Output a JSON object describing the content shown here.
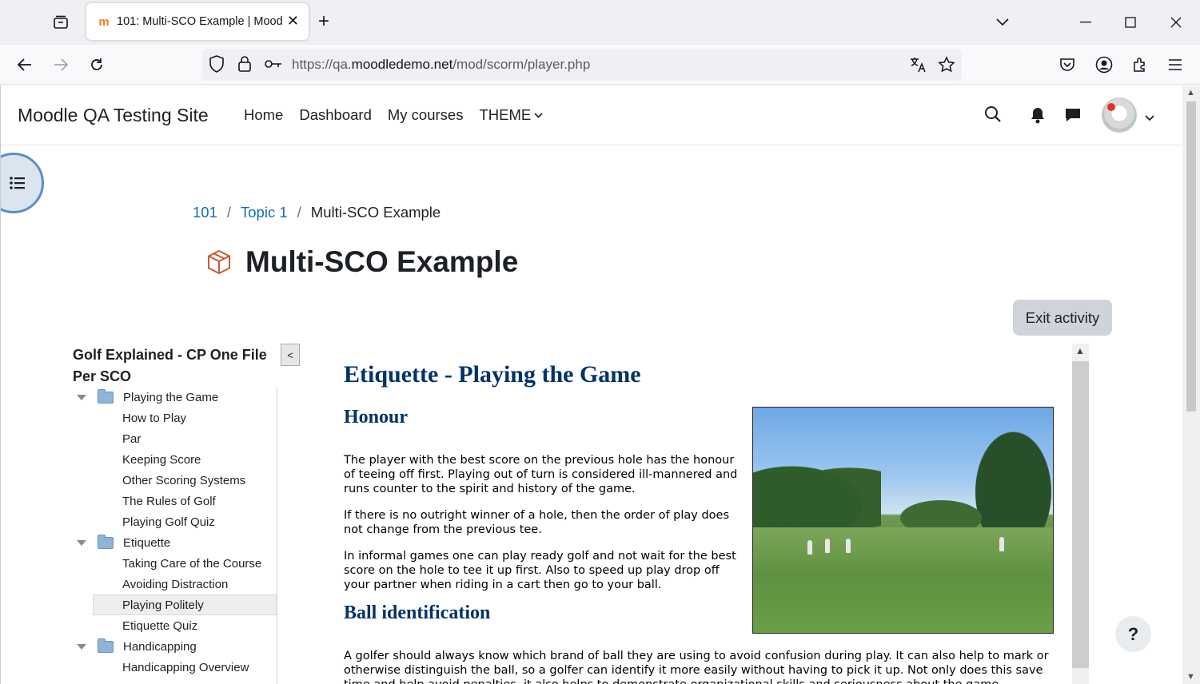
{
  "browser": {
    "tab": {
      "title": "101: Multi-SCO Example | Mood",
      "favicon": "moodle-favicon"
    },
    "url": {
      "prefix": "https://qa.",
      "domain": "moodledemo.net",
      "path": "/mod/scorm/player.php"
    },
    "icons": [
      "tab-list-icon",
      "back-icon",
      "forward-icon",
      "reload-icon",
      "shield-icon",
      "lock-icon",
      "key-icon",
      "translate-icon",
      "star-icon",
      "pocket-icon",
      "account-icon",
      "extensions-icon",
      "menu-icon",
      "minimize-icon",
      "maximize-icon",
      "close-icon"
    ]
  },
  "moodle": {
    "site_name": "Moodle QA Testing Site",
    "nav": {
      "home": "Home",
      "dashboard": "Dashboard",
      "my_courses": "My courses",
      "theme": "THEME"
    },
    "breadcrumb": {
      "course": "101",
      "sep": "/",
      "topic": "Topic 1",
      "current": "Multi-SCO Example"
    },
    "page_title": "Multi-SCO Example",
    "exit_button": "Exit activity",
    "help_button": "?"
  },
  "toc": {
    "title": "Golf Explained - CP One File Per SCO",
    "collapse_label": "<",
    "entries": [
      {
        "type": "folder",
        "label": "Playing the Game"
      },
      {
        "type": "item",
        "label": "How to Play"
      },
      {
        "type": "item",
        "label": "Par"
      },
      {
        "type": "item",
        "label": "Keeping Score"
      },
      {
        "type": "item",
        "label": "Other Scoring Systems"
      },
      {
        "type": "item",
        "label": "The Rules of Golf"
      },
      {
        "type": "item",
        "label": "Playing Golf Quiz"
      },
      {
        "type": "folder",
        "label": "Etiquette"
      },
      {
        "type": "item",
        "label": "Taking Care of the Course"
      },
      {
        "type": "item",
        "label": "Avoiding Distraction"
      },
      {
        "type": "item",
        "label": "Playing Politely",
        "active": true
      },
      {
        "type": "item",
        "label": "Etiquette Quiz"
      },
      {
        "type": "folder",
        "label": "Handicapping"
      },
      {
        "type": "item",
        "label": "Handicapping Overview"
      }
    ]
  },
  "sco": {
    "heading": "Etiquette - Playing the Game",
    "honour_heading": "Honour",
    "p1": "The player with the best score on the previous hole has the honour of teeing off first. Playing out of turn is considered ill-mannered and runs counter to the spirit and history of the game.",
    "p2": "If there is no outright winner of a hole, then the order of play does not change from the previous tee.",
    "p3": "In informal games one can play ready golf and not wait for the best score on the hole to tee it up first. Also to speed up play drop off your partner when riding in a cart then go to your ball.",
    "ball_heading": "Ball identification",
    "p4": "A golfer should always know which brand of ball they are using to avoid confusion during play. It can also help to mark or otherwise distinguish the ball, so a golfer can identify it more easily without having to pick it up. Not only does this save time and help avoid penalties, it also helps to demonstrate organizational skills and seriousness about the game."
  },
  "colors": {
    "link": "#0f6cbf",
    "sco_heading": "#003366",
    "activity_icon": "#c55c33"
  }
}
